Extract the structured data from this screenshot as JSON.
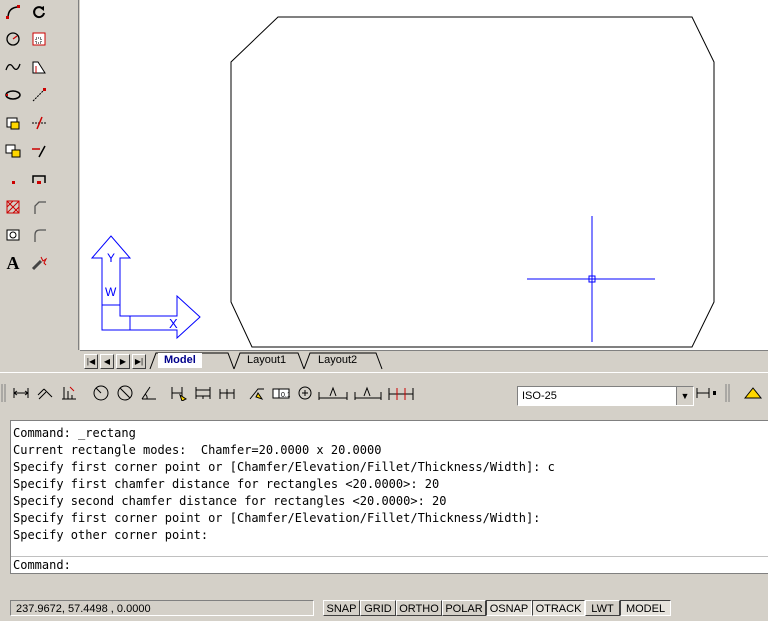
{
  "toolbar_left": {
    "col1": [
      "arc-icon",
      "circle-icon",
      "spline-icon",
      "ellipse-icon",
      "insert-block-icon",
      "make-block-icon",
      "point-icon",
      "hatch-icon",
      "region-icon",
      "multiline-text-icon"
    ],
    "col2": [
      "rotate-icon",
      "scale-icon",
      "stretch-icon",
      "trim-icon",
      "extend-icon",
      "break-icon",
      "join-icon",
      "chamfer-icon",
      "fillet-icon",
      "explode-icon"
    ],
    "text_label": "A"
  },
  "ucs": {
    "y_label": "Y",
    "w_label": "W",
    "x_label": "X"
  },
  "tabs": {
    "model": "Model",
    "layout1": "Layout1",
    "layout2": "Layout2"
  },
  "dim_toolbar": {
    "dimstyle_value": "ISO-25"
  },
  "command_window": {
    "lines": [
      "Command: _rectang",
      "Current rectangle modes:  Chamfer=20.0000 x 20.0000",
      "Specify first corner point or [Chamfer/Elevation/Fillet/Thickness/Width]: c",
      "Specify first chamfer distance for rectangles <20.0000>: 20",
      "Specify second chamfer distance for rectangles <20.0000>: 20",
      "Specify first corner point or [Chamfer/Elevation/Fillet/Thickness/Width]:",
      "Specify other corner point:"
    ],
    "prompt": "Command:"
  },
  "status_bar": {
    "coordinates": "237.9672, 57.4498 , 0.0000",
    "buttons": {
      "snap": "SNAP",
      "grid": "GRID",
      "ortho": "ORTHO",
      "polar": "POLAR",
      "osnap": "OSNAP",
      "otrack": "OTRACK",
      "lwt": "LWT",
      "model": "MODEL"
    }
  },
  "colors": {
    "cursor": "#0000ff",
    "ucs": "#0000ff",
    "active_tab_text": "#00008b"
  }
}
